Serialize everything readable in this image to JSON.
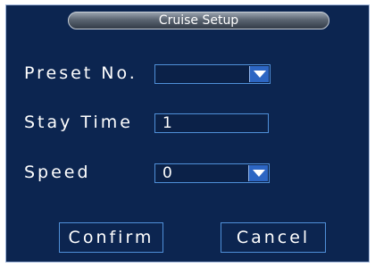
{
  "window": {
    "title": "Cruise Setup"
  },
  "form": {
    "preset_label": "Preset No.",
    "preset_value": "",
    "stay_time_label": "Stay Time",
    "stay_time_value": "1",
    "speed_label": "Speed",
    "speed_value": "0"
  },
  "buttons": {
    "confirm": "Confirm",
    "cancel": "Cancel"
  },
  "icons": {
    "dropdown": "chevron-down-icon"
  },
  "colors": {
    "background": "#0c2550",
    "field_border": "#4f8fd8",
    "dropdown_button": "#2d66c3",
    "text": "#ffffff"
  }
}
